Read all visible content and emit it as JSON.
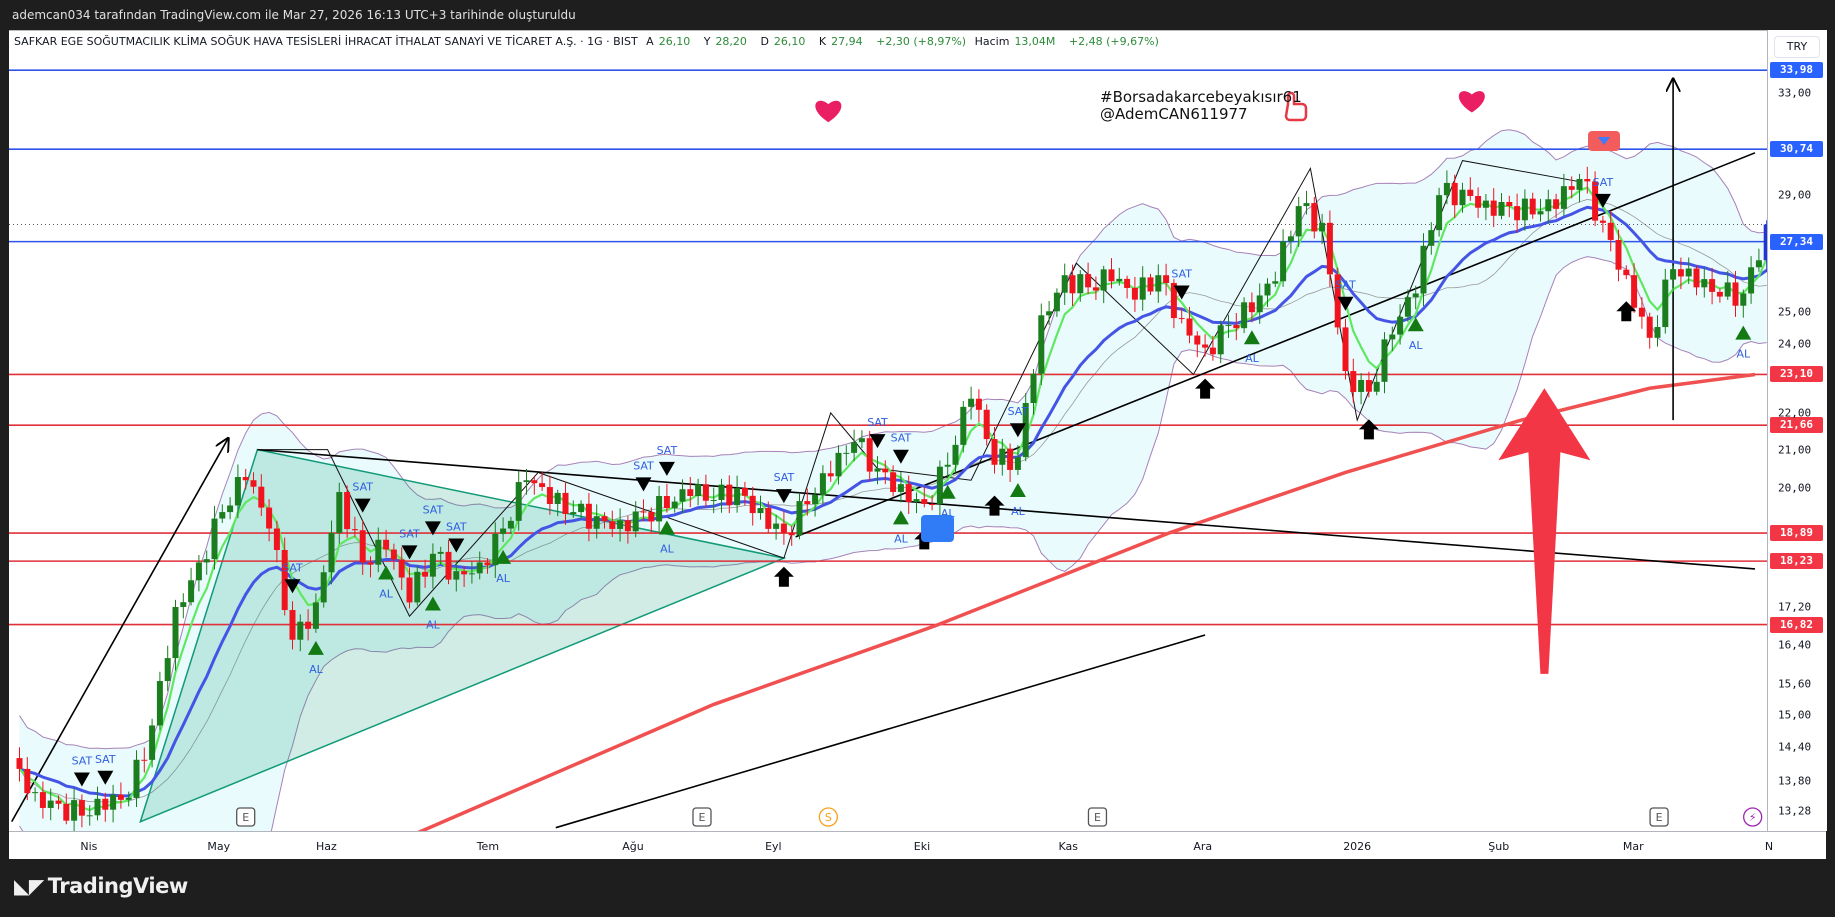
{
  "top_bar": {
    "caption": "ademcan034 tarafından TradingView.com ile Mar 27, 2026 16:13 UTC+3 tarihinde oluşturuldu"
  },
  "legend": {
    "symbol": "SAFKAR EGE SOĞUTMACILIK KLİMA SOĞUK HAVA TESİSLERİ İHRACAT İTHALAT SANAYİ VE TİCARET A.Ş. · 1G · BIST",
    "open_label": "A",
    "open": "26,10",
    "high_label": "Y",
    "high": "28,20",
    "low_label": "D",
    "low": "26,10",
    "close_label": "K",
    "close": "27,94",
    "change": "+2,30 (+8,97%)",
    "volume_label": "Hacim",
    "volume": "13,04M",
    "volume_change": "+2,48 (+9,67%)"
  },
  "annotation": {
    "hashtag": "#Borsadakarcebeyakısır61",
    "handle": "@AdemCAN611977"
  },
  "footer": {
    "logo_mark": "𝟏𝟕",
    "logo": "TradingView"
  },
  "colors": {
    "up": "#1b7d1e",
    "down": "#f0141e",
    "last": "#1f35d6",
    "blue_level": "#2f54eb",
    "red_level": "#e0303a",
    "fast_ma": "#5fe85f",
    "mid_ma": "#4455e6",
    "long_ma": "#f05050",
    "band": "#a782b8",
    "band_fill": "#e9fbfd",
    "marker_text": "#2f5fe0",
    "heart": "#e91e63",
    "arrow": "#f23645"
  },
  "chart_data": {
    "type": "candlestick",
    "title": "SAFKAR · 1G · BIST",
    "currency": "TRY",
    "scale": "log",
    "ylim": [
      13.0,
      34.5
    ],
    "closes": [
      14.2,
      13.6,
      13.4,
      13.2,
      13.3,
      13.5,
      14.8,
      17.2,
      18.2,
      19.4,
      20.2,
      19.0,
      16.5,
      17.3,
      19.9,
      18.2,
      18.5,
      17.3,
      18.4,
      18.0,
      18.2,
      19.0,
      20.2,
      19.6,
      19.4,
      19.3,
      19.2,
      19.4,
      19.5,
      19.8,
      19.7,
      20.0,
      19.5,
      18.9,
      19.6,
      20.3,
      21.2,
      20.5,
      20.1,
      19.6,
      20.6,
      22.4,
      20.6,
      20.8,
      24.9,
      26.2,
      25.8,
      26.0,
      25.4,
      26.2,
      24.8,
      23.9,
      24.6,
      25.0,
      26.0,
      28.6,
      28.0,
      23.2,
      22.6,
      24.3,
      25.6,
      29.0,
      29.2,
      28.8,
      28.6,
      28.3,
      28.5,
      29.6,
      28.0,
      26.2,
      24.2,
      26.4,
      25.8,
      25.5,
      25.6,
      27.94
    ],
    "last_price": 27.94,
    "price_ticks": [
      {
        "value": 33.0,
        "label": "33,00"
      },
      {
        "value": 29.0,
        "label": "29,00"
      },
      {
        "value": 25.0,
        "label": "25,00"
      },
      {
        "value": 24.0,
        "label": "24,00"
      },
      {
        "value": 22.0,
        "label": "22,00"
      },
      {
        "value": 21.0,
        "label": "21,00"
      },
      {
        "value": 20.0,
        "label": "20,00"
      },
      {
        "value": 17.2,
        "label": "17,20"
      },
      {
        "value": 16.4,
        "label": "16,40"
      },
      {
        "value": 15.6,
        "label": "15,60"
      },
      {
        "value": 15.0,
        "label": "15,00"
      },
      {
        "value": 14.4,
        "label": "14,40"
      },
      {
        "value": 13.8,
        "label": "13,80"
      },
      {
        "value": 13.28,
        "label": "13,28"
      }
    ],
    "levels": [
      {
        "value": 33.98,
        "label": "33,98",
        "color": "blue"
      },
      {
        "value": 30.74,
        "label": "30,74",
        "color": "blue"
      },
      {
        "value": 27.34,
        "label": "27,34",
        "color": "blue"
      },
      {
        "value": 23.1,
        "label": "23,10",
        "color": "red"
      },
      {
        "value": 21.66,
        "label": "21,66",
        "color": "red"
      },
      {
        "value": 18.89,
        "label": "18,89",
        "color": "red"
      },
      {
        "value": 18.23,
        "label": "18,23",
        "color": "red"
      },
      {
        "value": 16.82,
        "label": "16,82",
        "color": "red"
      }
    ],
    "time_labels": [
      {
        "label": "Nis",
        "i": 3.3
      },
      {
        "label": "May",
        "i": 8.85
      },
      {
        "label": "Haz",
        "i": 13.45
      },
      {
        "label": "Tem",
        "i": 20.35
      },
      {
        "label": "Ağu",
        "i": 26.55
      },
      {
        "label": "Eyl",
        "i": 32.55
      },
      {
        "label": "Eki",
        "i": 38.9
      },
      {
        "label": "Kas",
        "i": 45.15
      },
      {
        "label": "Ara",
        "i": 50.9
      },
      {
        "label": "2026",
        "i": 57.5
      },
      {
        "label": "Şub",
        "i": 63.55
      },
      {
        "label": "Mar",
        "i": 69.3
      },
      {
        "label": "N",
        "i": 75.1
      }
    ],
    "ma200": [
      {
        "i": 17.25,
        "p": 12.9
      },
      {
        "i": 30,
        "p": 15.2
      },
      {
        "i": 39.5,
        "p": 16.8
      },
      {
        "i": 49.5,
        "p": 18.9
      },
      {
        "i": 57,
        "p": 20.4
      },
      {
        "i": 64.5,
        "p": 21.8
      },
      {
        "i": 70,
        "p": 22.7
      },
      {
        "i": 74.5,
        "p": 23.1
      }
    ],
    "signals": [
      {
        "label": "SAT",
        "i": 3
      },
      {
        "label": "SAT",
        "i": 4
      },
      {
        "label": "SAT",
        "i": 12
      },
      {
        "label": "SAT",
        "i": 15
      },
      {
        "label": "SAT",
        "i": 17
      },
      {
        "label": "SAT",
        "i": 18
      },
      {
        "label": "SAT",
        "i": 19
      },
      {
        "label": "SAT",
        "i": 27
      },
      {
        "label": "SAT",
        "i": 28
      },
      {
        "label": "SAT",
        "i": 33
      },
      {
        "label": "SAT",
        "i": 37
      },
      {
        "label": "SAT",
        "i": 38
      },
      {
        "label": "SAT",
        "i": 43
      },
      {
        "label": "SAT",
        "i": 50
      },
      {
        "label": "SAT",
        "i": 57
      },
      {
        "label": "SAT",
        "i": 68
      },
      {
        "label": "AL",
        "i": 13
      },
      {
        "label": "AL",
        "i": 16
      },
      {
        "label": "AL",
        "i": 18
      },
      {
        "label": "AL",
        "i": 21
      },
      {
        "label": "AL",
        "i": 28
      },
      {
        "label": "AL",
        "i": 38
      },
      {
        "label": "AL",
        "i": 40
      },
      {
        "label": "AL",
        "i": 43
      },
      {
        "label": "AL",
        "i": 53
      },
      {
        "label": "AL",
        "i": 60
      },
      {
        "label": "AL",
        "i": 74
      }
    ],
    "up_arrows": [
      33,
      39,
      42,
      51,
      58,
      69
    ],
    "trendlines": [
      {
        "from": [
          10.5,
          21.0
        ],
        "to": [
          74.5,
          18.05
        ],
        "arrow": false
      },
      {
        "from": [
          33.5,
          18.8
        ],
        "to": [
          74.5,
          30.6
        ],
        "arrow": false
      },
      {
        "from": [
          23.25,
          13.0
        ],
        "to": [
          51,
          16.6
        ],
        "arrow": false
      },
      {
        "from": [
          0,
          13.1
        ],
        "to": [
          9.25,
          21.3
        ],
        "arrow": true
      },
      {
        "from": [
          71,
          21.8
        ],
        "to": [
          71,
          33.6
        ],
        "arrow": true
      }
    ],
    "zigzag": [
      [
        10.5,
        21.0
      ],
      [
        13.5,
        21.0
      ],
      [
        17,
        17.0
      ],
      [
        22.5,
        20.4
      ],
      [
        33,
        18.3
      ],
      [
        35,
        22.0
      ],
      [
        37,
        20.5
      ],
      [
        41,
        20.2
      ],
      [
        45.5,
        26.6
      ],
      [
        50.5,
        23.1
      ],
      [
        55.5,
        30.0
      ],
      [
        57.5,
        21.8
      ],
      [
        62,
        30.3
      ],
      [
        67,
        29.5
      ]
    ],
    "triangle_zone": [
      [
        5.5,
        13.1
      ],
      [
        10.5,
        21.0
      ],
      [
        33,
        18.3
      ]
    ],
    "big_arrow": {
      "i": 65.5,
      "from": 15.8,
      "to": 22.7
    },
    "hearts": [
      {
        "i": 34.9,
        "p": 32.3
      },
      {
        "i": 62.4,
        "p": 32.7
      }
    ],
    "events": [
      {
        "label": "E",
        "i": 10
      },
      {
        "label": "E",
        "i": 29.5
      },
      {
        "label": "S",
        "i": 34.9
      },
      {
        "label": "E",
        "i": 46.4
      },
      {
        "label": "E",
        "i": 70.4
      },
      {
        "label": "⚡",
        "i": 74.4
      }
    ]
  }
}
